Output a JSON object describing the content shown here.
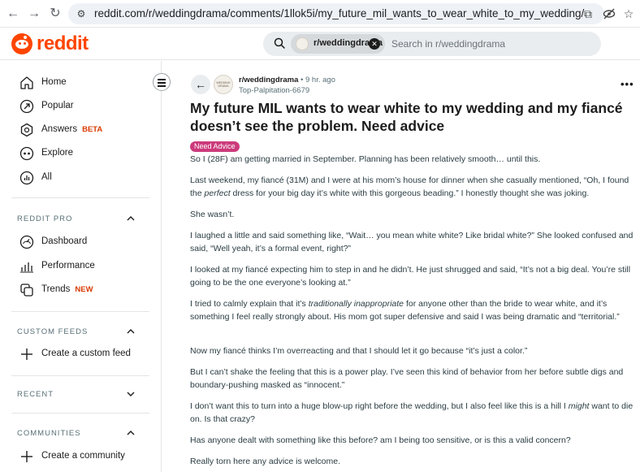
{
  "browser": {
    "url": "reddit.com/r/weddingdrama/comments/1llok5i/my_future_mil_wants_to_wear_white_to_my_wedding/"
  },
  "header": {
    "logo_text": "reddit",
    "search_chip": "r/weddingdrama",
    "search_placeholder": "Search in r/weddingdrama"
  },
  "sidebar": {
    "items": [
      {
        "label": "Home",
        "icon": "home-icon"
      },
      {
        "label": "Popular",
        "icon": "popular-icon"
      },
      {
        "label": "Answers",
        "badge": "BETA",
        "icon": "answers-icon"
      },
      {
        "label": "Explore",
        "icon": "explore-icon"
      },
      {
        "label": "All",
        "icon": "all-icon"
      }
    ],
    "reddit_pro": {
      "title": "REDDIT PRO",
      "items": [
        {
          "label": "Dashboard",
          "icon": "dashboard-icon"
        },
        {
          "label": "Performance",
          "icon": "performance-icon"
        },
        {
          "label": "Trends",
          "badge": "NEW",
          "icon": "trends-icon"
        }
      ]
    },
    "custom_feeds": {
      "title": "CUSTOM FEEDS",
      "action": "Create a custom feed"
    },
    "recent": {
      "title": "RECENT"
    },
    "communities": {
      "title": "COMMUNITIES",
      "action": "Create a community"
    }
  },
  "post": {
    "subreddit": "r/weddingdrama",
    "time": "9 hr. ago",
    "author": "Top-Palpitation-6679",
    "title": "My future MIL wants to wear white to my wedding and my fiancé doesn’t see the problem. Need advice",
    "flair": "Need Advice",
    "paragraphs": [
      {
        "text": "So I (28F) am getting married in September. Planning has been relatively smooth… until this."
      },
      {
        "before": "Last weekend, my fiancé (31M) and I were at his mom’s house for dinner when she casually mentioned, “Oh, I found the ",
        "em": "perfect",
        "after": " dress for your big day it’s white with this gorgeous beading.” I honestly thought she was joking."
      },
      {
        "text": "She wasn’t."
      },
      {
        "text": "I laughed a little and said something like, “Wait… you mean white white? Like bridal white?” She looked confused and said, “Well yeah, it’s a formal event, right?”"
      },
      {
        "text": "I looked at my fiancé expecting him to step in and he didn’t. He just shrugged and said, “It’s not a big deal. You’re still going to be the one everyone’s looking at.”"
      },
      {
        "before": "I tried to calmly explain that it’s ",
        "em": "traditionally inappropriate",
        "after": " for anyone other than the bride to wear white, and it’s something I feel really strongly about. His mom got super defensive and said I was being dramatic and “territorial.”"
      },
      {
        "text": "Now my fiancé thinks I’m overreacting and that I should let it go because “it’s just a color.”"
      },
      {
        "text": "But I can’t shake the feeling that this is a power play. I’ve seen this kind of behavior from her before subtle digs and boundary-pushing masked as “innocent.”"
      },
      {
        "before": "I don’t want this to turn into a huge blow-up right before the wedding, but I also feel like this is a hill I ",
        "em": "might",
        "after": " want to die on. Is that crazy?"
      },
      {
        "text": "Has anyone dealt with something like this before? am I being too sensitive, or is this a valid concern?"
      },
      {
        "text": "Really torn here any advice is welcome."
      }
    ]
  },
  "colors": {
    "brand": "#ff4500",
    "flair_bg": "#cc3b7c",
    "badge": "#d93a00"
  }
}
